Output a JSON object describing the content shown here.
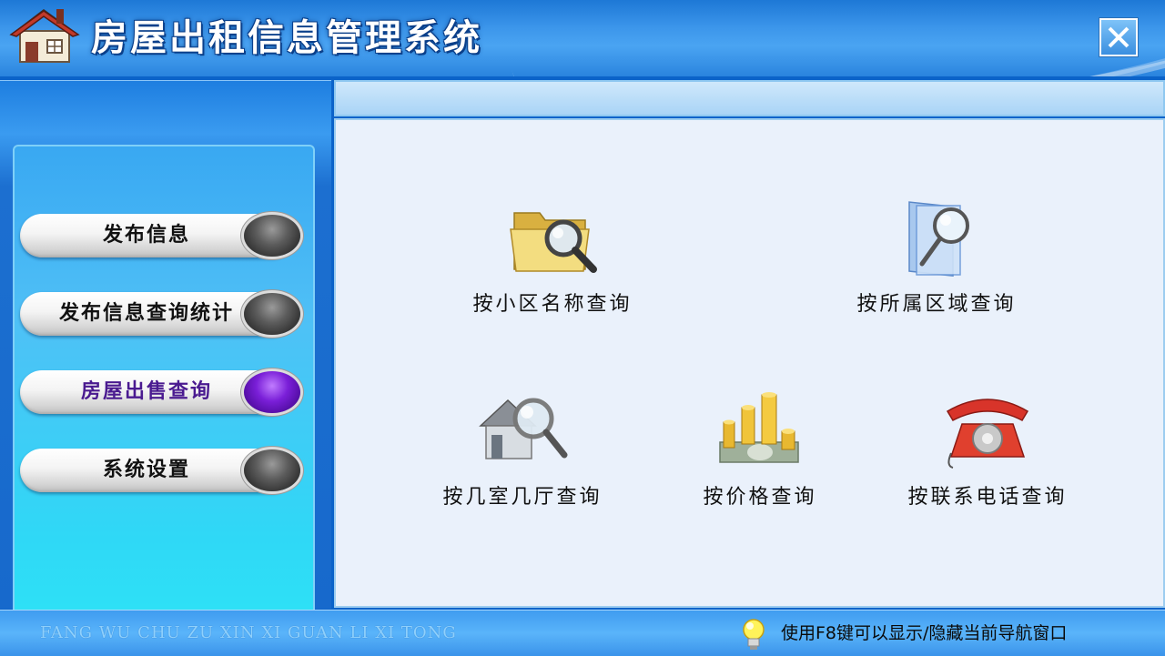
{
  "window": {
    "title": "房屋出租信息管理系统",
    "close_icon": "close-icon"
  },
  "nav": {
    "items": [
      {
        "label": "发布信息",
        "active": false
      },
      {
        "label": "发布信息查询统计",
        "active": false
      },
      {
        "label": "房屋出售查询",
        "active": true
      },
      {
        "label": "系统设置",
        "active": false
      }
    ]
  },
  "content": {
    "functions": [
      {
        "label": "按小区名称查询",
        "icon": "folder-search-icon"
      },
      {
        "label": "按所属区域查询",
        "icon": "document-search-icon"
      },
      {
        "label": "按几室几厅查询",
        "icon": "house-search-icon"
      },
      {
        "label": "按价格查询",
        "icon": "coins-icon"
      },
      {
        "label": "按联系电话查询",
        "icon": "telephone-icon"
      }
    ]
  },
  "status": {
    "pinyin": "FANG WU CHU ZU XIN XI GUAN LI XI TONG",
    "hint": "使用F8键可以显示/隐藏当前导航窗口",
    "hint_icon": "lightbulb-icon"
  },
  "colors": {
    "titlebar": "#3b95ea",
    "active_knob": "#7a1fd8",
    "content_bg": "#eaf1fb"
  }
}
